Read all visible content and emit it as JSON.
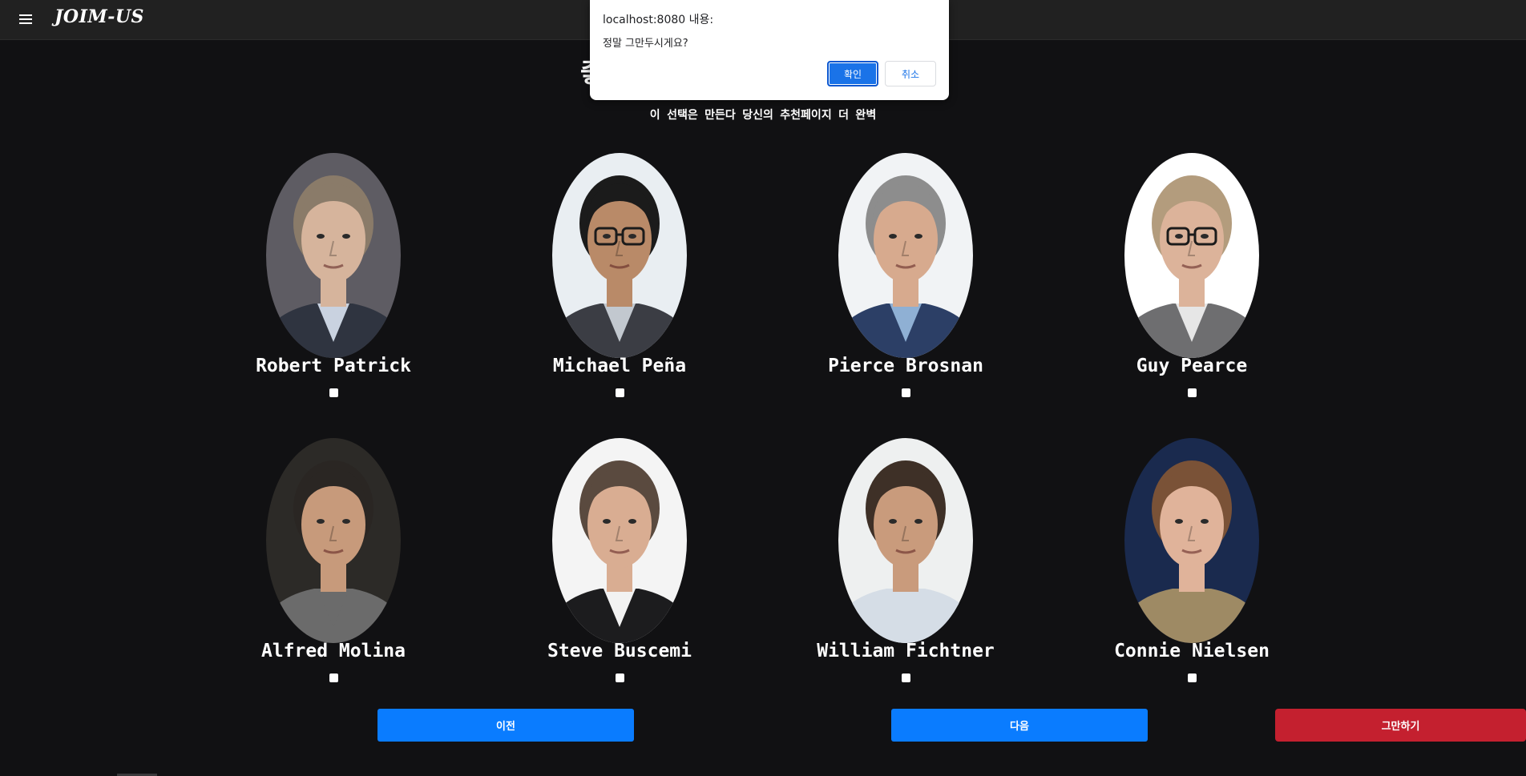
{
  "app": {
    "brand": "JOIM-US"
  },
  "page": {
    "title": "좋아하는 배우를 선택해 주세요🤍",
    "subtitle": "이 선택은 만든다 당신의 추천페이지 더 완벽"
  },
  "actors": [
    {
      "name": "Robert Patrick",
      "bg": "#5e5c63",
      "skin": "#d6b49c",
      "hair": "#8a7b69",
      "suit": "#2f3440",
      "shirt": "#c9d2e0",
      "glasses": false
    },
    {
      "name": "Michael Peña",
      "bg": "#e9eef2",
      "skin": "#b98a68",
      "hair": "#1b1b1b",
      "suit": "#3b3d44",
      "shirt": "#c2c8cf",
      "glasses": true
    },
    {
      "name": "Pierce Brosnan",
      "bg": "#f1f3f5",
      "skin": "#d7aa8e",
      "hair": "#8d8d8d",
      "suit": "#2c3f66",
      "shirt": "#8fb0d4",
      "glasses": false
    },
    {
      "name": "Guy Pearce",
      "bg": "#ffffff",
      "skin": "#dcb39a",
      "hair": "#b39c7d",
      "suit": "#6e6e70",
      "shirt": "#e6e6e6",
      "glasses": true
    },
    {
      "name": "Alfred Molina",
      "bg": "#2c2a27",
      "skin": "#c79a7b",
      "hair": "#2a2623",
      "suit": "#6b6b6b",
      "shirt": "#6b6b6b",
      "glasses": false
    },
    {
      "name": "Steve Buscemi",
      "bg": "#f4f4f4",
      "skin": "#d9ad92",
      "hair": "#5a4a3f",
      "suit": "#1c1c1e",
      "shirt": "#f2f2f2",
      "glasses": false
    },
    {
      "name": "William Fichtner",
      "bg": "#eef0f0",
      "skin": "#c99b7c",
      "hair": "#3e3027",
      "suit": "#d5dde6",
      "shirt": "#d5dde6",
      "glasses": false
    },
    {
      "name": "Connie Nielsen",
      "bg": "#1a2a4e",
      "skin": "#e0b39a",
      "hair": "#7a5237",
      "suit": "#9e8a64",
      "shirt": "#9e8a64",
      "glasses": false
    }
  ],
  "buttons": {
    "prev": "이전",
    "next": "다음",
    "quit": "그만하기"
  },
  "dialog": {
    "origin": "localhost:8080 내용:",
    "message": "정말 그만두시게요?",
    "ok": "확인",
    "cancel": "취소"
  },
  "colors": {
    "primary": "#0a7cff",
    "danger": "#c4202f",
    "background": "#111113",
    "topbar": "#212121"
  }
}
